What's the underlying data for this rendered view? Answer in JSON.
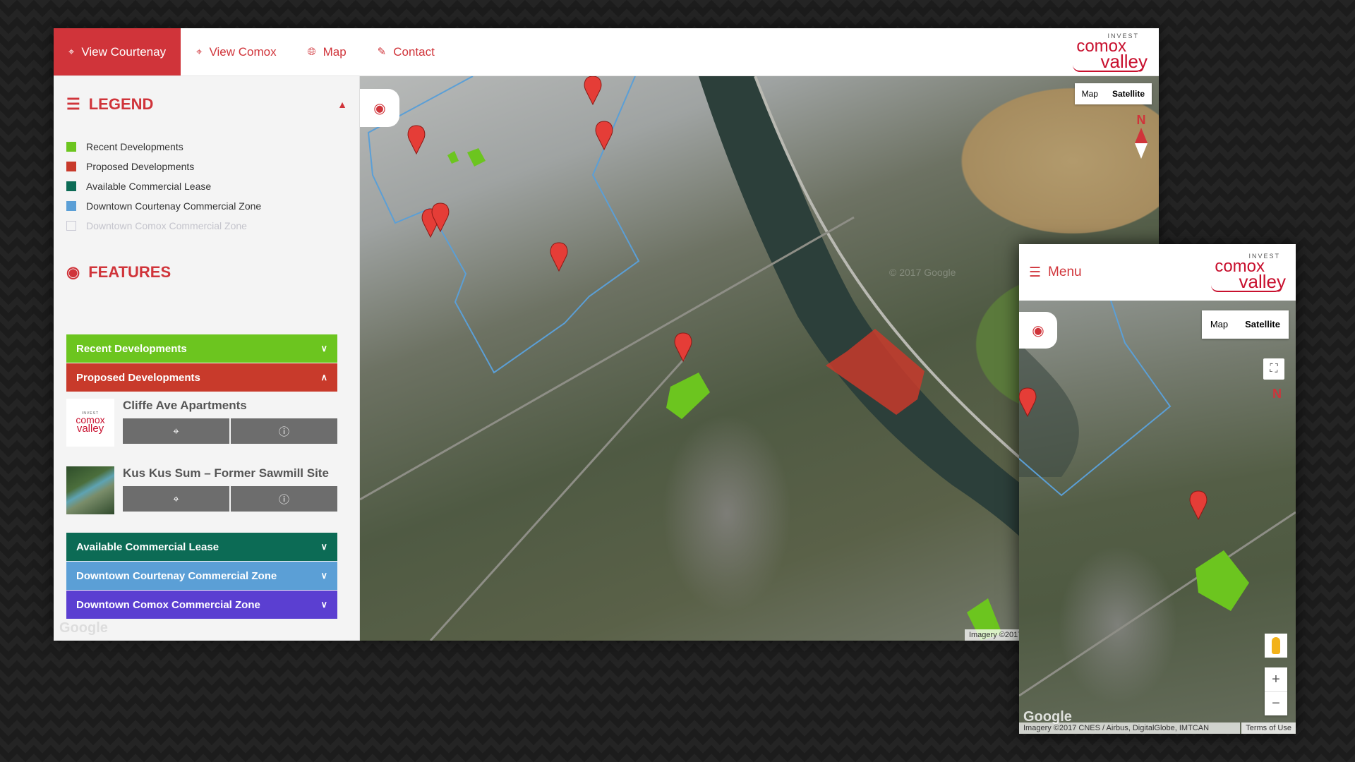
{
  "nav": {
    "items": [
      {
        "label": "View Courtenay",
        "icon": "crosshair-icon"
      },
      {
        "label": "View Comox",
        "icon": "crosshair-icon"
      },
      {
        "label": "Map",
        "icon": "globe-icon"
      },
      {
        "label": "Contact",
        "icon": "edit-icon"
      }
    ],
    "active_label": "View Courtenay"
  },
  "brand": {
    "invest": "INVEST",
    "comox": "comox",
    "valley": "valley"
  },
  "legend": {
    "title": "LEGEND",
    "items": [
      {
        "label": "Recent Developments",
        "color": "#6cc51f"
      },
      {
        "label": "Proposed Developments",
        "color": "#c83a2b"
      },
      {
        "label": "Available Commercial Lease",
        "color": "#0c6b55"
      },
      {
        "label": "Downtown Courtenay Commercial Zone",
        "color": "#5b9fd6"
      },
      {
        "label": "Downtown Comox Commercial Zone",
        "color": null
      }
    ]
  },
  "features": {
    "title": "FEATURES",
    "groups": [
      {
        "label": "Recent Developments",
        "color": "#6cc51f",
        "expanded": false
      },
      {
        "label": "Proposed Developments",
        "color": "#c83a2b",
        "expanded": true
      },
      {
        "label": "Available Commercial Lease",
        "color": "#0c6b55",
        "expanded": false
      },
      {
        "label": "Downtown Courtenay Commercial Zone",
        "color": "#5b9fd6",
        "expanded": false
      },
      {
        "label": "Downtown Comox Commercial Zone",
        "color": "#5b3fd1",
        "expanded": false
      }
    ],
    "proposed_items": [
      {
        "title": "Cliffe Ave Apartments",
        "thumb": "invest-comox-valley-logo"
      },
      {
        "title": "Kus Kus Sum – Former Sawmill Site",
        "thumb": "aerial-photo"
      }
    ]
  },
  "map": {
    "type_options": [
      "Map",
      "Satellite"
    ],
    "selected_type": "Satellite",
    "compass_label": "N",
    "attribution": "Imagery ©2017 CNES / Airbus, DigitalGlobe, IMTCAN",
    "watermark": "© 2017 Google",
    "google": "Google"
  },
  "mobile": {
    "menu_label": "Menu",
    "type_options": [
      "Map",
      "Satellite"
    ],
    "attribution": "Imagery ©2017 CNES / Airbus, DigitalGlobe, IMTCAN",
    "terms": "Terms of Use",
    "zoom_in": "+",
    "zoom_out": "−"
  }
}
